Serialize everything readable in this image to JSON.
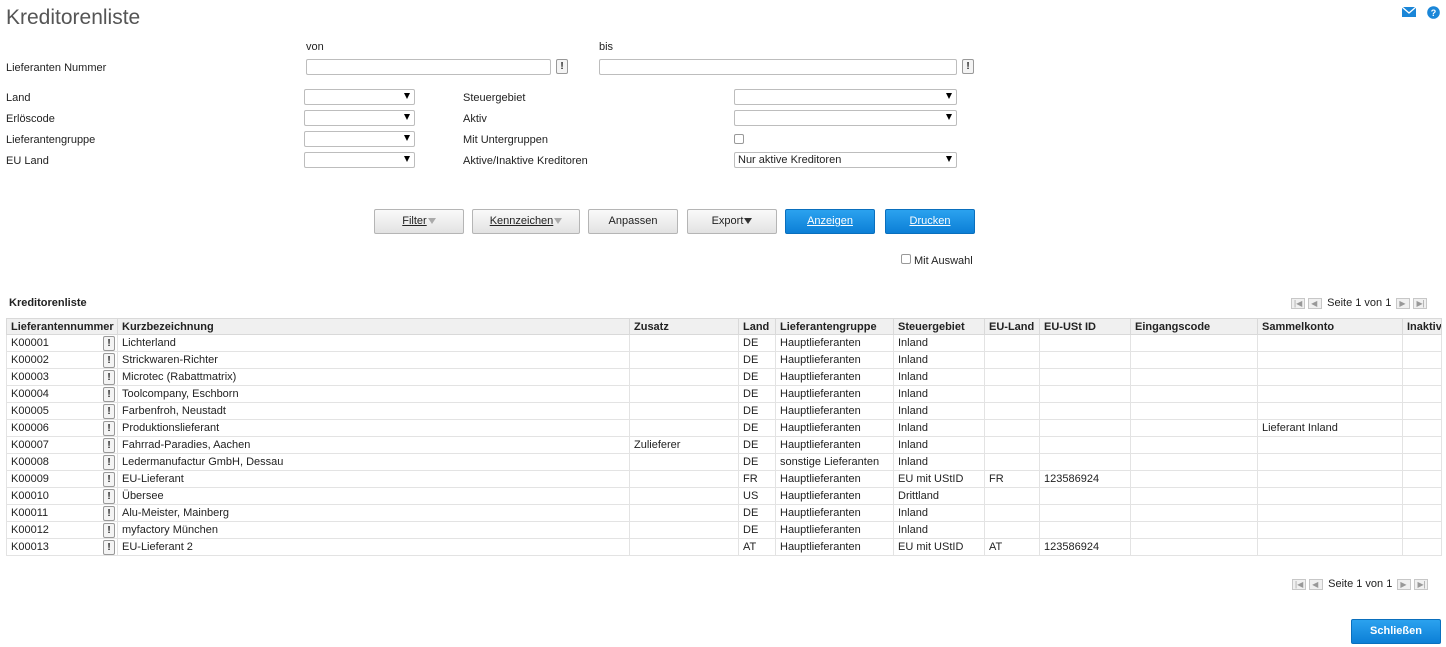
{
  "page": {
    "title": "Kreditorenliste"
  },
  "header_icons": [
    "mail-icon",
    "help-icon"
  ],
  "form": {
    "von_label": "von",
    "bis_label": "bis",
    "lieferanten_nummer_label": "Lieferanten Nummer",
    "von_value": "",
    "bis_value": "",
    "bang": "!",
    "land_label": "Land",
    "land_value": "",
    "erloescode_label": "Erlöscode",
    "erloescode_value": "",
    "lieferantengruppe_label": "Lieferantengruppe",
    "lieferantengruppe_value": "",
    "eu_land_label": "EU Land",
    "eu_land_value": "",
    "steuergebiet_label": "Steuergebiet",
    "steuergebiet_value": "",
    "aktiv_label": "Aktiv",
    "aktiv_value": "",
    "mit_untergruppen_label": "Mit Untergruppen",
    "mit_untergruppen_checked": false,
    "aktive_inaktive_label": "Aktive/Inaktive Kreditoren",
    "aktive_inaktive_value": "Nur aktive Kreditoren"
  },
  "toolbar": {
    "filter_label": "Filter",
    "kennzeichen_label": "Kennzeichen",
    "anpassen_label": "Anpassen",
    "export_label": "Export",
    "anzeigen_label": "Anzeigen",
    "drucken_label": "Drucken",
    "mit_auswahl_label": "Mit Auswahl",
    "mit_auswahl_checked": false
  },
  "list": {
    "title": "Kreditorenliste",
    "pager_text": "Seite 1 von 1",
    "columns": [
      "Lieferantennummer",
      "Kurzbezeichnung",
      "Zusatz",
      "Land",
      "Lieferantengruppe",
      "Steuergebiet",
      "EU-Land",
      "EU-USt ID",
      "Eingangscode",
      "Sammelkonto",
      "Inaktiv"
    ],
    "rows": [
      [
        "K00001",
        "Lichterland",
        "",
        "DE",
        "Hauptlieferanten",
        "Inland",
        "",
        "",
        "",
        "",
        ""
      ],
      [
        "K00002",
        "Strickwaren-Richter",
        "",
        "DE",
        "Hauptlieferanten",
        "Inland",
        "",
        "",
        "",
        "",
        ""
      ],
      [
        "K00003",
        "Microtec (Rabattmatrix)",
        "",
        "DE",
        "Hauptlieferanten",
        "Inland",
        "",
        "",
        "",
        "",
        ""
      ],
      [
        "K00004",
        "Toolcompany, Eschborn",
        "",
        "DE",
        "Hauptlieferanten",
        "Inland",
        "",
        "",
        "",
        "",
        ""
      ],
      [
        "K00005",
        "Farbenfroh, Neustadt",
        "",
        "DE",
        "Hauptlieferanten",
        "Inland",
        "",
        "",
        "",
        "",
        ""
      ],
      [
        "K00006",
        "Produktionslieferant",
        "",
        "DE",
        "Hauptlieferanten",
        "Inland",
        "",
        "",
        "",
        "Lieferant Inland",
        ""
      ],
      [
        "K00007",
        "Fahrrad-Paradies, Aachen",
        "Zulieferer",
        "DE",
        "Hauptlieferanten",
        "Inland",
        "",
        "",
        "",
        "",
        ""
      ],
      [
        "K00008",
        "Ledermanufactur GmbH, Dessau",
        "",
        "DE",
        "sonstige Lieferanten",
        "Inland",
        "",
        "",
        "",
        "",
        ""
      ],
      [
        "K00009",
        "EU-Lieferant",
        "",
        "FR",
        "Hauptlieferanten",
        "EU mit UStID",
        "FR",
        "123586924",
        "",
        "",
        ""
      ],
      [
        "K00010",
        "Übersee",
        "",
        "US",
        "Hauptlieferanten",
        "Drittland",
        "",
        "",
        "",
        "",
        ""
      ],
      [
        "K00011",
        "Alu-Meister, Mainberg",
        "",
        "DE",
        "Hauptlieferanten",
        "Inland",
        "",
        "",
        "",
        "",
        ""
      ],
      [
        "K00012",
        "myfactory München",
        "",
        "DE",
        "Hauptlieferanten",
        "Inland",
        "",
        "",
        "",
        "",
        ""
      ],
      [
        "K00013",
        "EU-Lieferant 2",
        "",
        "AT",
        "Hauptlieferanten",
        "EU mit UStID",
        "AT",
        "123586924",
        "",
        "",
        ""
      ]
    ]
  },
  "footer": {
    "schliessen_label": "Schließen"
  },
  "colors": {
    "accent": "#0c7fd6",
    "header_bg": "#f0f0f0"
  }
}
